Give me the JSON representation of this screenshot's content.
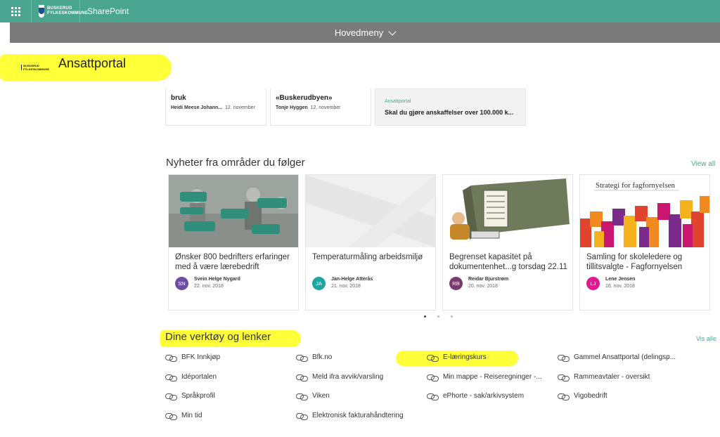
{
  "suite_bar": {
    "app_launcher_icon": "waffle-icon",
    "org_logo_text": "BUSKERUD FYLKESKOMMUNE",
    "app_name": "SharePoint"
  },
  "nav": {
    "menu_label": "Hovedmeny",
    "menu_icon": "chevron-down-icon"
  },
  "site": {
    "logo_text": "BUSKERUD FYLKESKOMMUNE",
    "title": "Ansattportal"
  },
  "top_cards": [
    {
      "title": "bruk",
      "author": "Heidi Meese Johann...",
      "date": "12. november"
    },
    {
      "title": "«Buskerudbyen»",
      "author": "Tonje Hyggen",
      "date": "12. november"
    },
    {
      "source": "Ansattportal",
      "title": "Skal du gjøre anskaffelser over 100.000 k..."
    }
  ],
  "news": {
    "heading": "Nyheter fra områder du følger",
    "view_all": "View all",
    "items": [
      {
        "title": "Ønsker 800 bedrifters erfaringer med å være lærebedrift",
        "initials": "SN",
        "author": "Svein Helge Nygard",
        "date": "22. nov. 2018",
        "avatar_color": "#6b4ea0"
      },
      {
        "title": "Temperaturmåling arbeidsmiljø",
        "initials": "JA",
        "author": "Jan-Helge Atterås",
        "date": "21. nov. 2018",
        "avatar_color": "#1fa3a3"
      },
      {
        "title": "Begrenset kapasitet på dokumentenhet...g torsdag 22.11",
        "initials": "RB",
        "author": "Reidar Bjurstrøm",
        "date": "20. nov. 2018",
        "avatar_color": "#7b3b6e"
      },
      {
        "title": "Samling for skoleledere og tillitsvalgte - Fagfornyelsen",
        "initials": "LJ",
        "author": "Lene Jensen",
        "date": "16. nov. 2018",
        "avatar_color": "#e0198e",
        "image_title": "Strategi for fagfornyelsen"
      }
    ],
    "page_dots": 3,
    "active_dot": 0
  },
  "tools": {
    "heading": "Dine verktøy og lenker",
    "view_all": "Vis alle",
    "link_icon": "link-icon",
    "links": [
      "BFK Innkjøp",
      "Bfk.no",
      "E-læringskurs",
      "Gammel Ansattportal (delingsp...",
      "Idéportalen",
      "Meld ifra avvik/varsling",
      "Min mappe - Reiseregninger -...",
      "Rammeavtaler - oversikt",
      "Språkprofil",
      "Viken",
      "ePhorte - sak/arkivsystem",
      "Vigobedrift",
      "Min tid",
      "Elektronisk fakturahåndtering"
    ]
  },
  "highlight_color": "#ffff3a",
  "accent_color": "#4aa58e"
}
